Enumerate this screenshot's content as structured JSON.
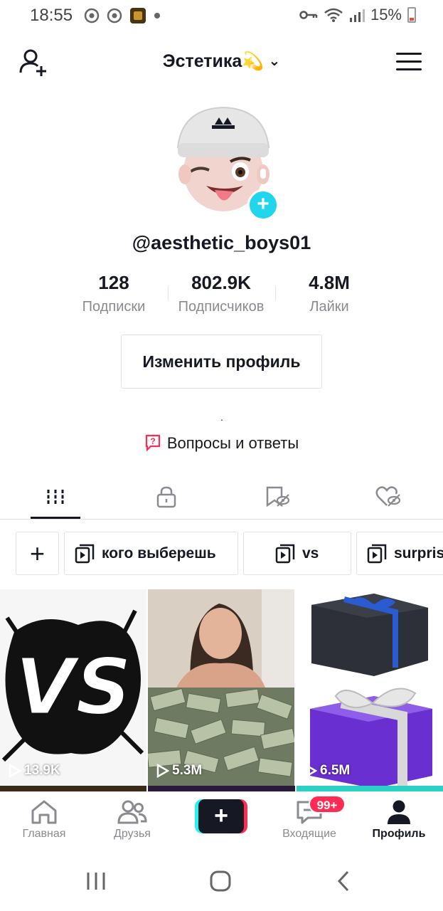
{
  "status_bar": {
    "time": "18:55",
    "battery": "15%"
  },
  "header": {
    "account_name": "Эстетика💫",
    "icons": [
      "add-friend-icon",
      "chevron-down-icon",
      "menu-icon"
    ]
  },
  "profile": {
    "username": "@aesthetic_boys01",
    "stats": [
      {
        "value": "128",
        "label": "Подписки"
      },
      {
        "value": "802.9K",
        "label": "Подписчиков"
      },
      {
        "value": "4.8M",
        "label": "Лайки"
      }
    ],
    "edit_button": "Изменить профиль",
    "bio": ".",
    "qa_link": "Вопросы и ответы"
  },
  "tabs": [
    {
      "name": "videos",
      "icon": "grid-icon",
      "active": true
    },
    {
      "name": "private",
      "icon": "lock-icon",
      "active": false
    },
    {
      "name": "favorites",
      "icon": "bookmark-hidden-icon",
      "active": false
    },
    {
      "name": "liked",
      "icon": "heart-hidden-icon",
      "active": false
    }
  ],
  "playlists": [
    {
      "label": "кого выберешь"
    },
    {
      "label": "vs"
    },
    {
      "label": "surprise"
    }
  ],
  "videos": [
    {
      "views": "13.9K"
    },
    {
      "views": "5.3M"
    },
    {
      "views": "6.5M"
    }
  ],
  "bottom_nav": {
    "home": "Главная",
    "friends": "Друзья",
    "inbox": "Входящие",
    "inbox_badge": "99+",
    "profile": "Профиль"
  },
  "colors": {
    "accent_red": "#fe2c55",
    "accent_cyan": "#25f4ee",
    "badge_cyan": "#20d5ec",
    "text": "#161823",
    "muted": "#8a8b91"
  }
}
